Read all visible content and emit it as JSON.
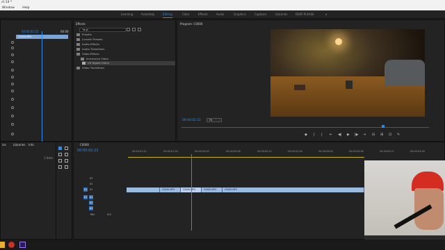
{
  "window": {
    "title_fragment": "ct 14 *",
    "menu": [
      "Window",
      "Help"
    ]
  },
  "workspaces": {
    "items": [
      "Learning",
      "Assembly",
      "Editing",
      "Color",
      "Effects",
      "Audio",
      "Graphics",
      "Captions",
      "Libraries",
      "DEEP PLEASE"
    ],
    "active": "Editing",
    "more": "»"
  },
  "source_panel": {
    "timecode_left": "00:00:02:22",
    "timecode_right": "00:00",
    "clip_name": "C0000.MP4"
  },
  "effects_panel": {
    "title": "Effects",
    "search_value": "\"w gl",
    "tree": [
      {
        "label": "Presets",
        "level": 0
      },
      {
        "label": "Lumetri Presets",
        "level": 0
      },
      {
        "label": "Audio Effects",
        "level": 0
      },
      {
        "label": "Audio Transitions",
        "level": 0
      },
      {
        "label": "Video Effects",
        "level": 0
      },
      {
        "label": "Immersive Video",
        "level": 1
      },
      {
        "label": "VR Digital Glitch",
        "level": 2,
        "selected": true
      },
      {
        "label": "Video Transitions",
        "level": 0
      }
    ]
  },
  "program_monitor": {
    "title": "Program: C0000",
    "timecode": "00:00:02:22",
    "fit": "Fit",
    "transport": [
      "◆",
      "|",
      "|",
      "⇤",
      "◀|",
      "▶",
      "|▶",
      "⇥",
      "⊟",
      "⊞",
      "⊡",
      "✎"
    ]
  },
  "project_panel": {
    "tabs": [
      "ies",
      "Libraries",
      "Info"
    ],
    "label": "1 Item"
  },
  "timeline": {
    "sequence_name": "C0000",
    "timecode": "00:00:02:22",
    "ruler": [
      "00:00:01:12",
      "00:00:01:18",
      "00:00:02:00",
      "00:00:02:06",
      "00:00:02:12",
      "00:00:02:18",
      "00:00:03:00",
      "00:00:03:06",
      "00:00:03:12",
      "00:00:03:18"
    ],
    "video_tracks": [
      "V3",
      "V2",
      "V1"
    ],
    "audio_tracks": [
      "A1",
      "A2",
      "A3"
    ],
    "master": "Mix",
    "master_value": "0.0",
    "clips": [
      "C0000.MP4",
      "C0000.MP4",
      "C0000.MP4",
      "C0000.MP4"
    ]
  },
  "colors": {
    "accent": "#2d8ceb",
    "clip": "#9bbbe0",
    "panel": "#232323"
  }
}
